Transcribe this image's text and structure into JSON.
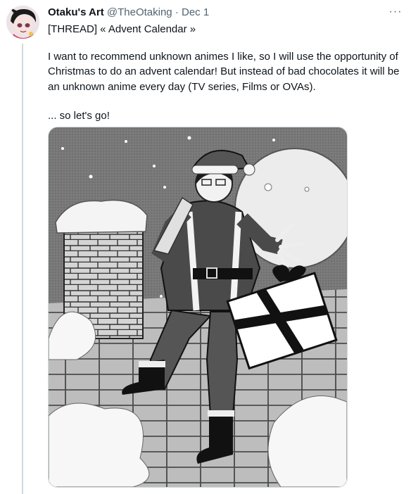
{
  "tweet": {
    "author_name": "Otaku's Art",
    "author_handle": "@TheOtaking",
    "separator": "·",
    "timestamp": "Dec 1",
    "more_menu": "···",
    "thread_title": "[THREAD] « Advent Calendar »",
    "paragraph": "I want to recommend unknown animes I like, so I will use the opportunity of Christmas to do an advent calendar! But instead of bad chocolates it will be an unknown anime every day (TV series, Films or OVAs).",
    "closing": "... so let's go!"
  },
  "colors": {
    "text_primary": "#0f1419",
    "text_secondary": "#536471",
    "border": "#cfd9de"
  },
  "icons": [
    "more-options-icon"
  ],
  "media": {
    "type": "manga illustration",
    "alt": ""
  }
}
